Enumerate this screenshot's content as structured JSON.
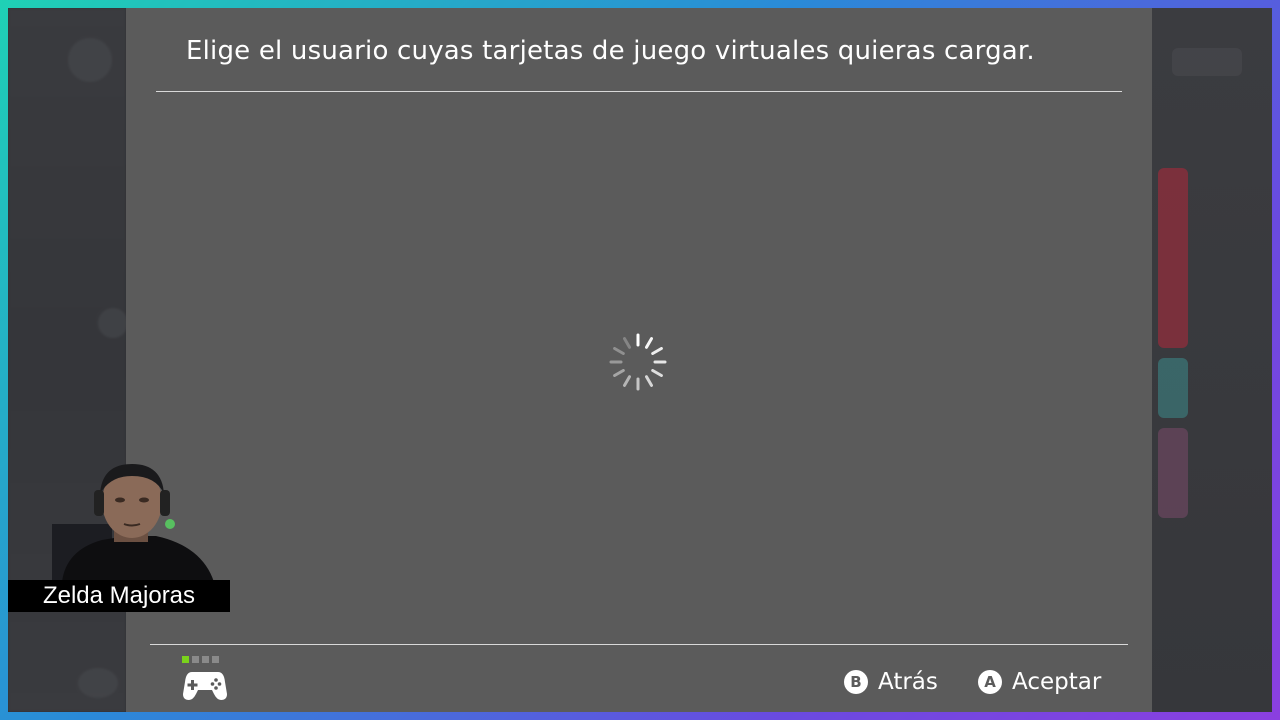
{
  "dialog": {
    "title": "Elige el usuario cuyas tarjetas de juego virtuales quieras cargar.",
    "loading_icon": "spinner-icon"
  },
  "footer": {
    "back": {
      "key": "B",
      "label": "Atrás"
    },
    "accept": {
      "key": "A",
      "label": "Aceptar"
    },
    "controller_icon": "gamepad-icon",
    "player_indicator": {
      "active": 1,
      "total": 4
    }
  },
  "overlay": {
    "streamer_name": "Zelda Majoras"
  },
  "colors": {
    "dialog_bg": "#5b5b5b",
    "indicator_active": "#7ad21c",
    "frame_gradient": [
      "#1fd1b5",
      "#2a8ad8",
      "#8b3fe0"
    ]
  }
}
